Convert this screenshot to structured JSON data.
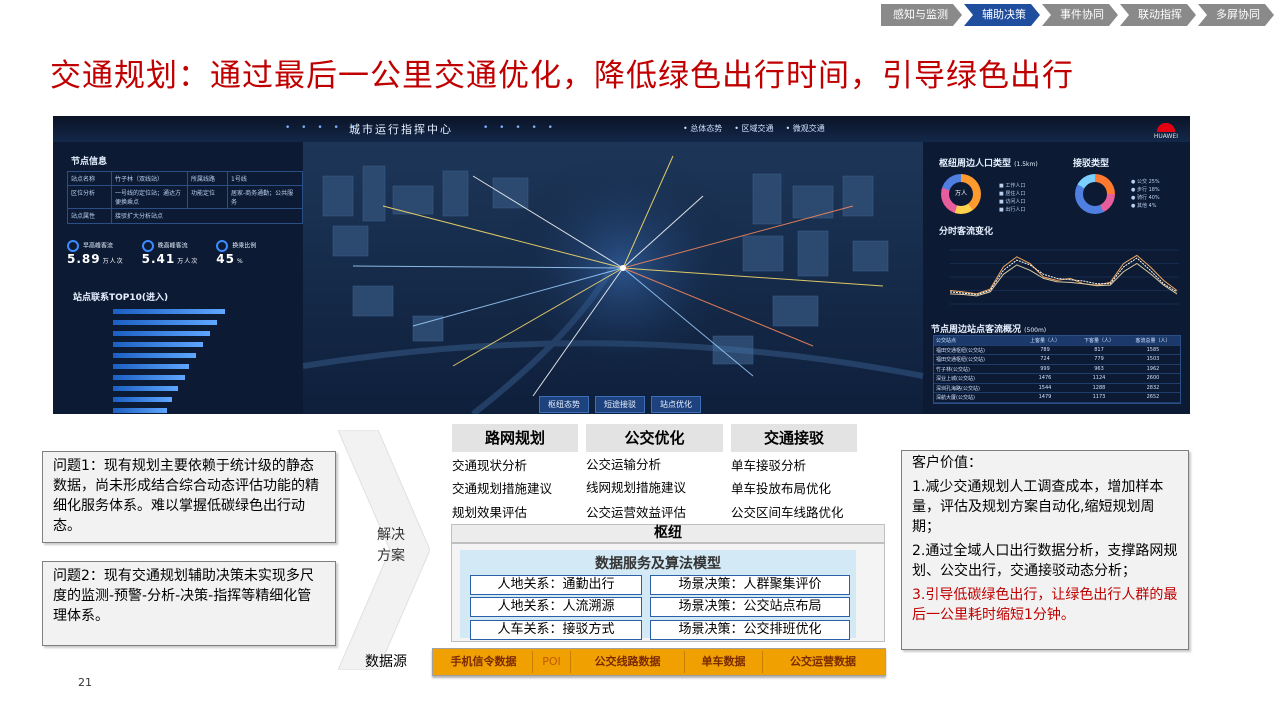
{
  "nav": [
    "感知与监测",
    "辅助决策",
    "事件协同",
    "联动指挥",
    "多屏协同"
  ],
  "nav_active_index": 1,
  "title": "交通规划：通过最后一公里交通优化，降低绿色出行时间，引导绿色出行",
  "dashboard": {
    "header_title": "城市运行指挥中心",
    "header_tabs": [
      "• 总体态势",
      "• 区域交通",
      "• 微观交通"
    ],
    "brand": "HUAWEI",
    "left_panel_title": "节点信息",
    "node_table": [
      [
        "站点名称",
        "竹子林（双线站）",
        "所属线路",
        "1号线"
      ],
      [
        "区位分析",
        "一号线的定位站；通达方便换乘点",
        "功能定位",
        "居家-商务通勤；公共服务"
      ],
      [
        "站点属性",
        "接驳扩大分析站点",
        "",
        ""
      ]
    ],
    "kpis": [
      {
        "label": "早高峰客流",
        "value": "5.89",
        "unit": "万人次"
      },
      {
        "label": "晚高峰客流",
        "value": "5.41",
        "unit": "万人次"
      },
      {
        "label": "换乘比例",
        "value": "45",
        "unit": "%"
      }
    ],
    "top10_title": "站点联系TOP10(进入)",
    "top10_values": [
      0.62,
      0.58,
      0.54,
      0.5,
      0.46,
      0.42,
      0.4,
      0.36,
      0.33,
      0.3
    ],
    "bottom_tabs": [
      "枢纽态势",
      "短途接驳",
      "站点优化"
    ],
    "right_title_1": "枢纽周边人口类型",
    "right_title_1_unit": "(1.5km)",
    "right_title_2": "接驳类型",
    "right_title_3": "分时客流变化",
    "right_title_4": "节点周边站点客流概况",
    "right_title_4_unit": "(500m)",
    "donut1_center": "万人",
    "donut1_legend": [
      "工作人口",
      "居住人口",
      "访问人口",
      "出行人口"
    ],
    "donut2_legend": [
      "公交",
      "步行",
      "骑行",
      "其他"
    ],
    "donut2_pcts": [
      "25%",
      "18%",
      "40%",
      "4%"
    ],
    "station_table_head": [
      "公交站点",
      "上客量（人）",
      "下客量（人）",
      "客流总量（人）"
    ],
    "station_table_rows": [
      [
        "福田交通枢纽(公交站)",
        "789",
        "817",
        "1585"
      ],
      [
        "福田交通枢纽(公交站)",
        "724",
        "779",
        "1503"
      ],
      [
        "竹子林(公交站)",
        "999",
        "963",
        "1962"
      ],
      [
        "深业上城(公交站)",
        "1476",
        "1124",
        "2600"
      ],
      [
        "深圳孔海路(公交站)",
        "1544",
        "1288",
        "2832"
      ],
      [
        "深航大厦(公交站)",
        "1479",
        "1173",
        "2652"
      ]
    ],
    "line_chart": {
      "type": "line",
      "series": [
        {
          "values": [
            20,
            18,
            15,
            22,
            55,
            70,
            60,
            40,
            35,
            38,
            30,
            28,
            32,
            60,
            72,
            55,
            35,
            20
          ]
        },
        {
          "values": [
            18,
            16,
            14,
            20,
            50,
            65,
            58,
            44,
            38,
            36,
            34,
            30,
            30,
            55,
            68,
            50,
            30,
            18
          ]
        },
        {
          "values": [
            15,
            14,
            12,
            18,
            44,
            58,
            50,
            38,
            33,
            32,
            30,
            27,
            28,
            48,
            60,
            45,
            28,
            15
          ]
        }
      ]
    }
  },
  "problems": [
    "问题1：现有规划主要依赖于统计级的静态数据，尚未形成结合综合动态评估功能的精细化服务体系。难以掌握低碳绿色出行动态。",
    "问题2：现有交通规划辅助决策未实现多尺度的监测-预警-分析-决策-指挥等精细化管理体系。"
  ],
  "solve_label_1": "解决",
  "solve_label_2": "方案",
  "columns": [
    {
      "head": "路网规划",
      "items": [
        "交通现状分析",
        "交通规划措施建议",
        "规划效果评估"
      ]
    },
    {
      "head": "公交优化",
      "items": [
        "公交运输分析",
        "线网规划措施建议",
        "公交运营效益评估"
      ]
    },
    {
      "head": "交通接驳",
      "items": [
        "单车接驳分析",
        "单车投放布局优化",
        "公交区间车线路优化"
      ]
    }
  ],
  "hub": "枢纽",
  "model_title": "数据服务及算法模型",
  "model_boxes": [
    "人地关系：通勤出行",
    "场景决策：人群聚集评价",
    "人地关系：人流溯源",
    "场景决策：公交站点布局",
    "人车关系：接驳方式",
    "场景决策：公交排班优化"
  ],
  "data_source_label": "数据源",
  "data_sources": [
    "手机信令数据",
    "POI",
    "公交线路数据",
    "单车数据",
    "公交运营数据"
  ],
  "value_title": "客户价值：",
  "values": [
    "1.减少交通规划人工调查成本，增加样本量，评估及规划方案自动化,缩短规划周期；",
    "2.通过全域人口出行数据分析，支撑路网规划、公交出行，交通接驳动态分析；",
    "3.引导低碳绿色出行，让绿色出行人群的最后一公里耗时缩短1分钟。"
  ],
  "page_number": "21",
  "colors": {
    "accent": "#1f4e9e",
    "title_red": "#c00000",
    "orange": "#f0a000"
  }
}
